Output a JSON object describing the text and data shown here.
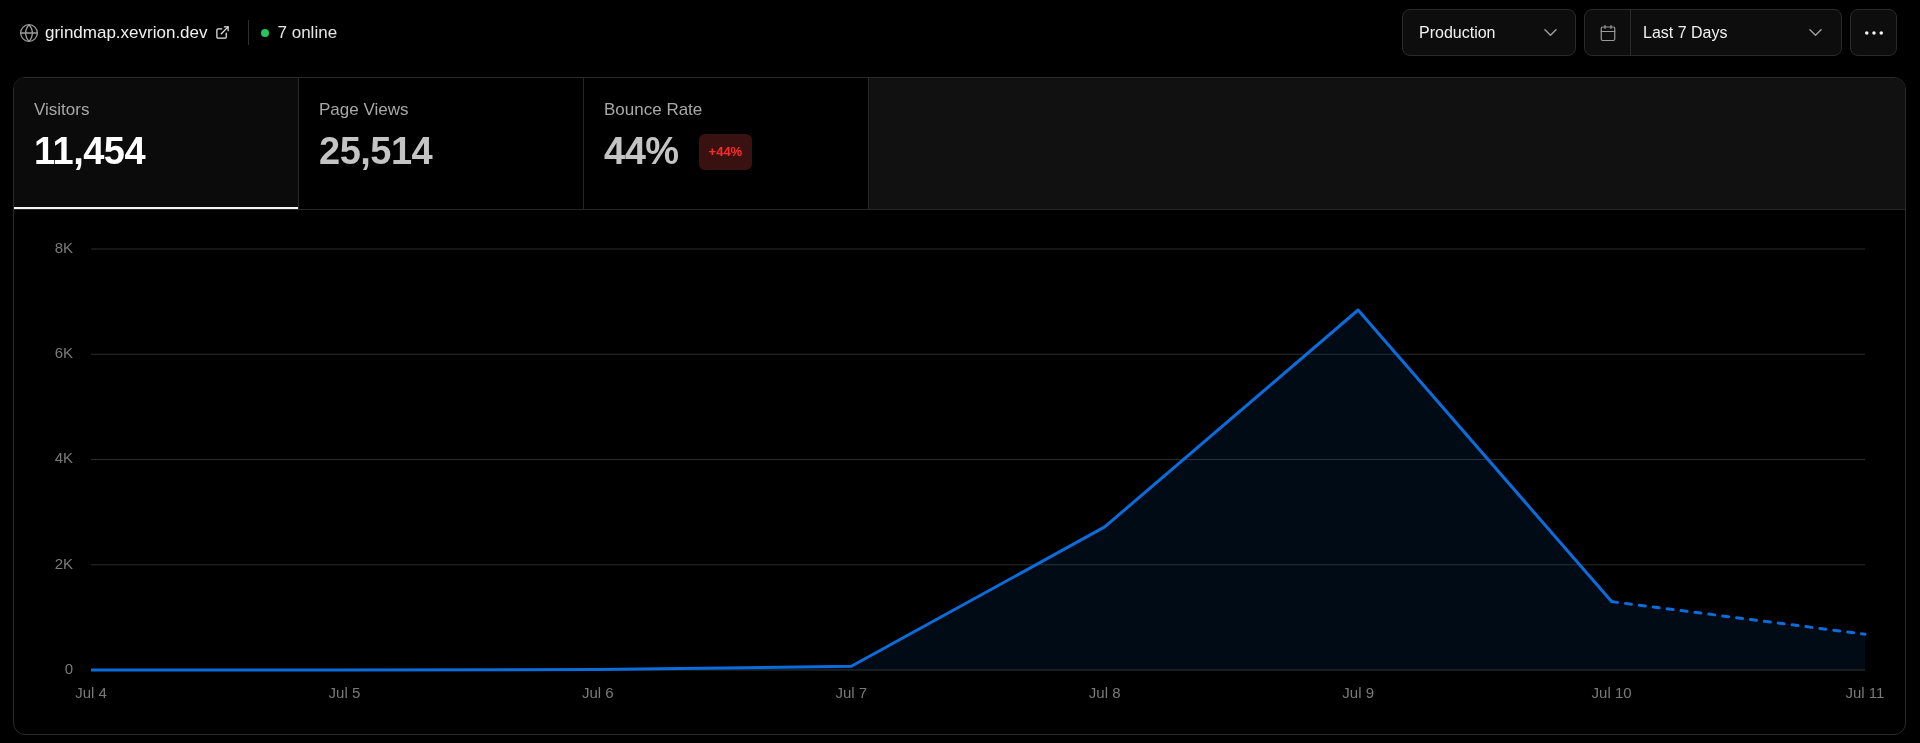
{
  "header": {
    "site": {
      "domain": "grindmap.xevrion.dev"
    },
    "presence": {
      "label": "7 online"
    },
    "environment": {
      "value": "Production"
    },
    "date_range": {
      "value": "Last 7 Days"
    }
  },
  "stats": [
    {
      "label": "Visitors",
      "value": "11,454",
      "selected": true
    },
    {
      "label": "Page Views",
      "value": "25,514",
      "selected": false
    },
    {
      "label": "Bounce Rate",
      "value": "44%",
      "selected": false,
      "badge": {
        "text": "+44%",
        "kind": "negative"
      }
    }
  ],
  "chart": {
    "chart_data": {
      "type": "area",
      "grid": true,
      "categories": [
        "Jul 4",
        "Jul 5",
        "Jul 6",
        "Jul 7",
        "Jul 8",
        "Jul 9",
        "Jul 10",
        "Jul 11"
      ],
      "series": [
        {
          "color": "#0b6cdb",
          "values": [
            0,
            0,
            10,
            70,
            2720,
            6840,
            1300,
            null
          ]
        },
        {
          "color": "#0b6cdb",
          "values": [
            null,
            null,
            null,
            null,
            null,
            null,
            1300,
            680
          ]
        }
      ],
      "ylim": [
        0,
        8000
      ],
      "yticks": [
        {
          "value": 0,
          "label": "0"
        },
        {
          "value": 2000,
          "label": "2K"
        },
        {
          "value": 4000,
          "label": "4K"
        },
        {
          "value": 6000,
          "label": "6K"
        },
        {
          "value": 8000,
          "label": "8K"
        }
      ]
    }
  }
}
